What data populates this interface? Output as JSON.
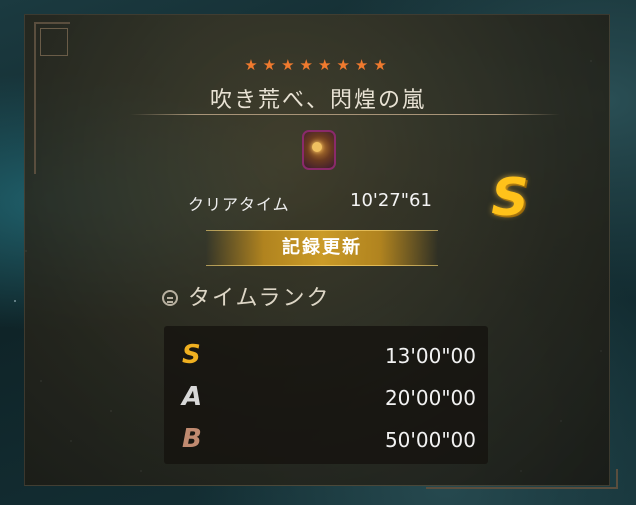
{
  "quest": {
    "stars": "★★★★★★★★",
    "title": "吹き荒べ、閃煌の嵐"
  },
  "result": {
    "clear_time_label": "クリアタイム",
    "clear_time_value": "10'27\"61",
    "rank": "S",
    "record_label": "記録更新"
  },
  "time_rank": {
    "header": "タイムランク",
    "rows": [
      {
        "rank": "S",
        "time": "13'00\"00",
        "color": "#f0b020"
      },
      {
        "rank": "A",
        "time": "20'00\"00",
        "color": "#d8d8d8"
      },
      {
        "rank": "B",
        "time": "50'00\"00",
        "color": "#c08a70"
      }
    ]
  },
  "colors": {
    "star": "#f07a2e",
    "rank_gold": "#ffc21a",
    "record_bar": "#d2a028"
  }
}
